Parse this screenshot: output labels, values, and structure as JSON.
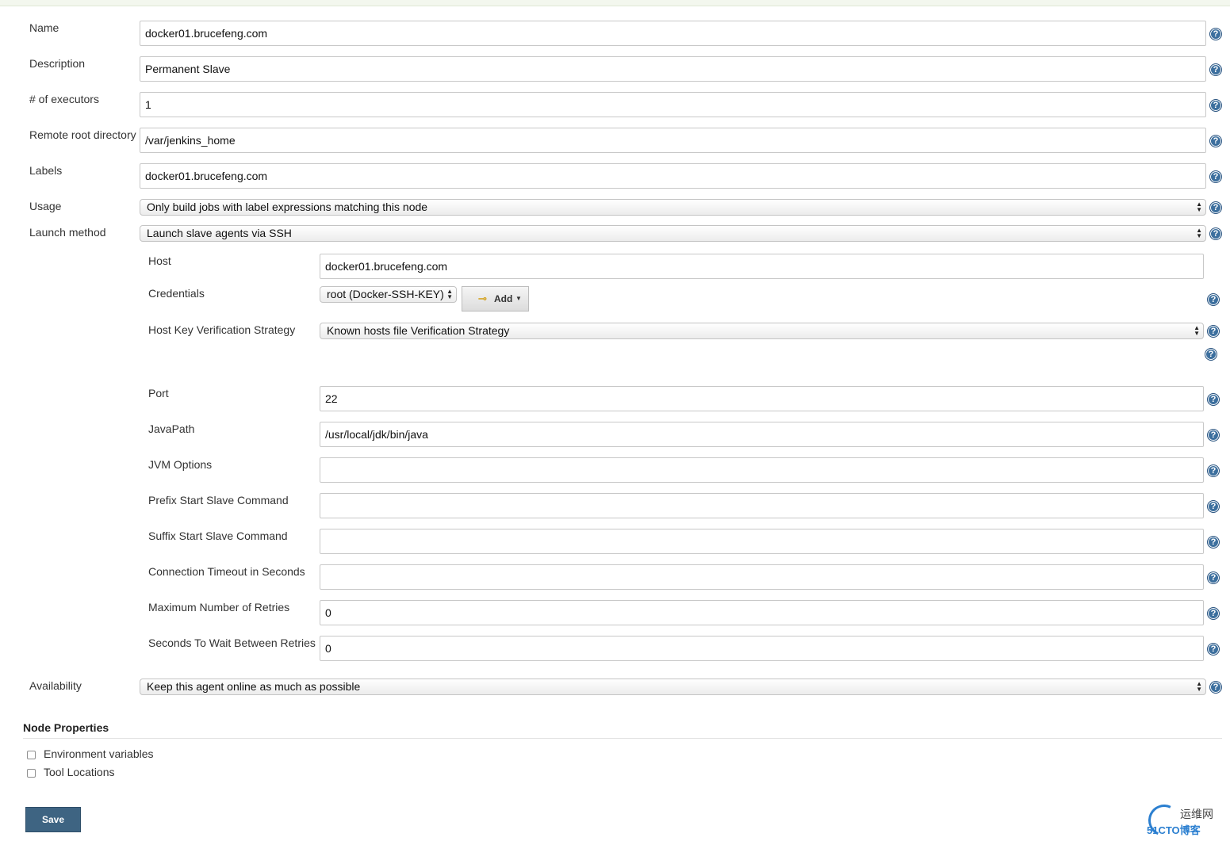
{
  "form": {
    "name": {
      "label": "Name",
      "value": "docker01.brucefeng.com"
    },
    "description": {
      "label": "Description",
      "value": "Permanent Slave"
    },
    "executors": {
      "label": "# of executors",
      "value": "1"
    },
    "remote_root": {
      "label": "Remote root directory",
      "value": "/var/jenkins_home"
    },
    "labels": {
      "label": "Labels",
      "value": "docker01.brucefeng.com"
    },
    "usage": {
      "label": "Usage",
      "value": "Only build jobs with label expressions matching this node"
    },
    "launch_method": {
      "label": "Launch method",
      "value": "Launch slave agents via SSH"
    }
  },
  "ssh": {
    "host": {
      "label": "Host",
      "value": "docker01.brucefeng.com"
    },
    "credentials": {
      "label": "Credentials",
      "value": "root (Docker-SSH-KEY)",
      "add_label": "Add"
    },
    "host_key": {
      "label": "Host Key Verification Strategy",
      "value": "Known hosts file Verification Strategy"
    },
    "port": {
      "label": "Port",
      "value": "22"
    },
    "java_path": {
      "label": "JavaPath",
      "value": "/usr/local/jdk/bin/java"
    },
    "jvm_options": {
      "label": "JVM Options",
      "value": ""
    },
    "prefix_cmd": {
      "label": "Prefix Start Slave Command",
      "value": ""
    },
    "suffix_cmd": {
      "label": "Suffix Start Slave Command",
      "value": ""
    },
    "timeout": {
      "label": "Connection Timeout in Seconds",
      "value": ""
    },
    "max_retries": {
      "label": "Maximum Number of Retries",
      "value": "0"
    },
    "retry_wait": {
      "label": "Seconds To Wait Between Retries",
      "value": "0"
    }
  },
  "availability": {
    "label": "Availability",
    "value": "Keep this agent online as much as possible"
  },
  "node_properties": {
    "title": "Node Properties",
    "items": [
      {
        "label": "Environment variables",
        "checked": false
      },
      {
        "label": "Tool Locations",
        "checked": false
      }
    ]
  },
  "save_label": "Save",
  "help_glyph": "?",
  "watermark": {
    "line1": "运维网",
    "line2": "51CTO博客"
  },
  "colors": {
    "save_button": "#3e6482",
    "help_icon": "#3c6f9e"
  }
}
